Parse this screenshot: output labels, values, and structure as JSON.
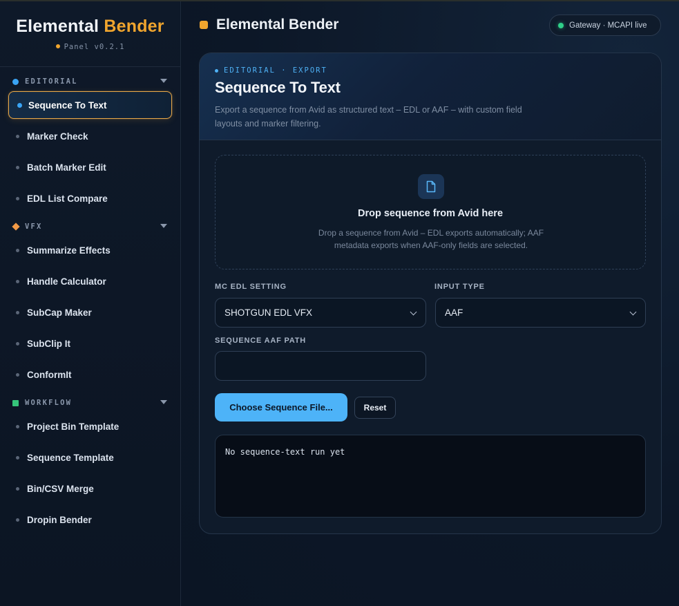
{
  "brand": {
    "title_main": "Elemental",
    "title_accent": "Bender",
    "version": "Panel v0.2.1"
  },
  "sidebar": {
    "sections": [
      {
        "label": "EDITORIAL",
        "icon": "blue-circle-icon",
        "items": [
          "Sequence To Text",
          "Marker Check",
          "Batch Marker Edit",
          "EDL List Compare"
        ]
      },
      {
        "label": "VFX",
        "icon": "orange-diamond-icon",
        "items": [
          "Summarize Effects",
          "Handle Calculator",
          "SubCap Maker",
          "SubClip It",
          "ConformIt"
        ]
      },
      {
        "label": "WORKFLOW",
        "icon": "green-square-icon",
        "items": [
          "Project Bin Template",
          "Sequence Template",
          "Bin/CSV Merge",
          "Dropin Bender"
        ]
      }
    ],
    "active_item": "Sequence To Text"
  },
  "header": {
    "title": "Elemental Bender",
    "gateway_status": "Gateway · MCAPI live"
  },
  "card": {
    "eyebrow": "EDITORIAL · EXPORT",
    "title": "Sequence To Text",
    "description": "Export a sequence from Avid as structured text – EDL or AAF – with custom field layouts and marker filtering."
  },
  "dropzone": {
    "icon": "document-icon",
    "title": "Drop sequence from Avid here",
    "description": "Drop a sequence from Avid – EDL exports automatically; AAF metadata exports when AAF-only fields are selected."
  },
  "form": {
    "mc_edl_setting": {
      "label": "MC EDL SETTING",
      "value": "SHOTGUN EDL VFX"
    },
    "input_type": {
      "label": "INPUT TYPE",
      "value": "AAF"
    },
    "sequence_aaf_path": {
      "label": "SEQUENCE AAF PATH",
      "value": ""
    }
  },
  "actions": {
    "choose_label": "Choose Sequence File...",
    "reset_label": "Reset"
  },
  "output": {
    "text": "No sequence-text run yet"
  },
  "colors": {
    "accent_orange": "#f0a52e",
    "accent_blue": "#4db3f8",
    "status_green": "#2fd089",
    "background": "#0b1524"
  }
}
